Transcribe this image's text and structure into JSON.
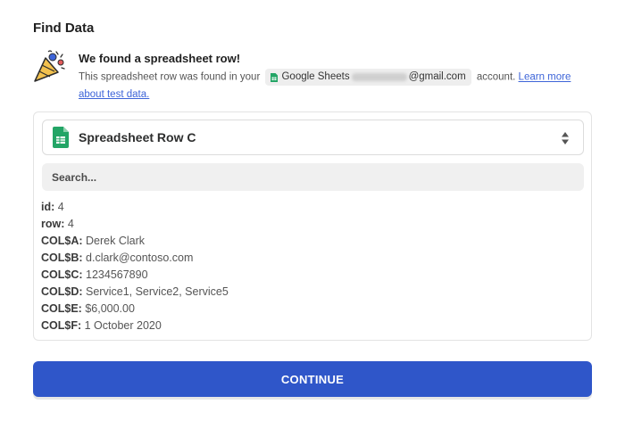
{
  "section_title": "Find Data",
  "found": {
    "title": "We found a spreadsheet row!",
    "desc_prefix": "This spreadsheet row was found in your",
    "app_name": "Google Sheets",
    "email_suffix": "@gmail.com",
    "desc_suffix": "account.",
    "learn_more": "Learn more about test data."
  },
  "row_select": {
    "label": "Spreadsheet Row C"
  },
  "search": {
    "placeholder": "Search..."
  },
  "fields": [
    {
      "key": "id:",
      "value": "4"
    },
    {
      "key": "row:",
      "value": "4"
    },
    {
      "key": "COL$A:",
      "value": "Derek Clark"
    },
    {
      "key": "COL$B:",
      "value": "d.clark@contoso.com"
    },
    {
      "key": "COL$C:",
      "value": "1234567890"
    },
    {
      "key": "COL$D:",
      "value": "Service1, Service2, Service5"
    },
    {
      "key": "COL$E:",
      "value": "$6,000.00"
    },
    {
      "key": "COL$F:",
      "value": "1 October 2020"
    }
  ],
  "continue_label": "CONTINUE",
  "colors": {
    "primary": "#2f56c9",
    "link": "#3d64d8",
    "sheets_green": "#23a566"
  },
  "icons": [
    "party-popper-icon",
    "google-sheets-icon",
    "up-down-arrow-icon"
  ]
}
